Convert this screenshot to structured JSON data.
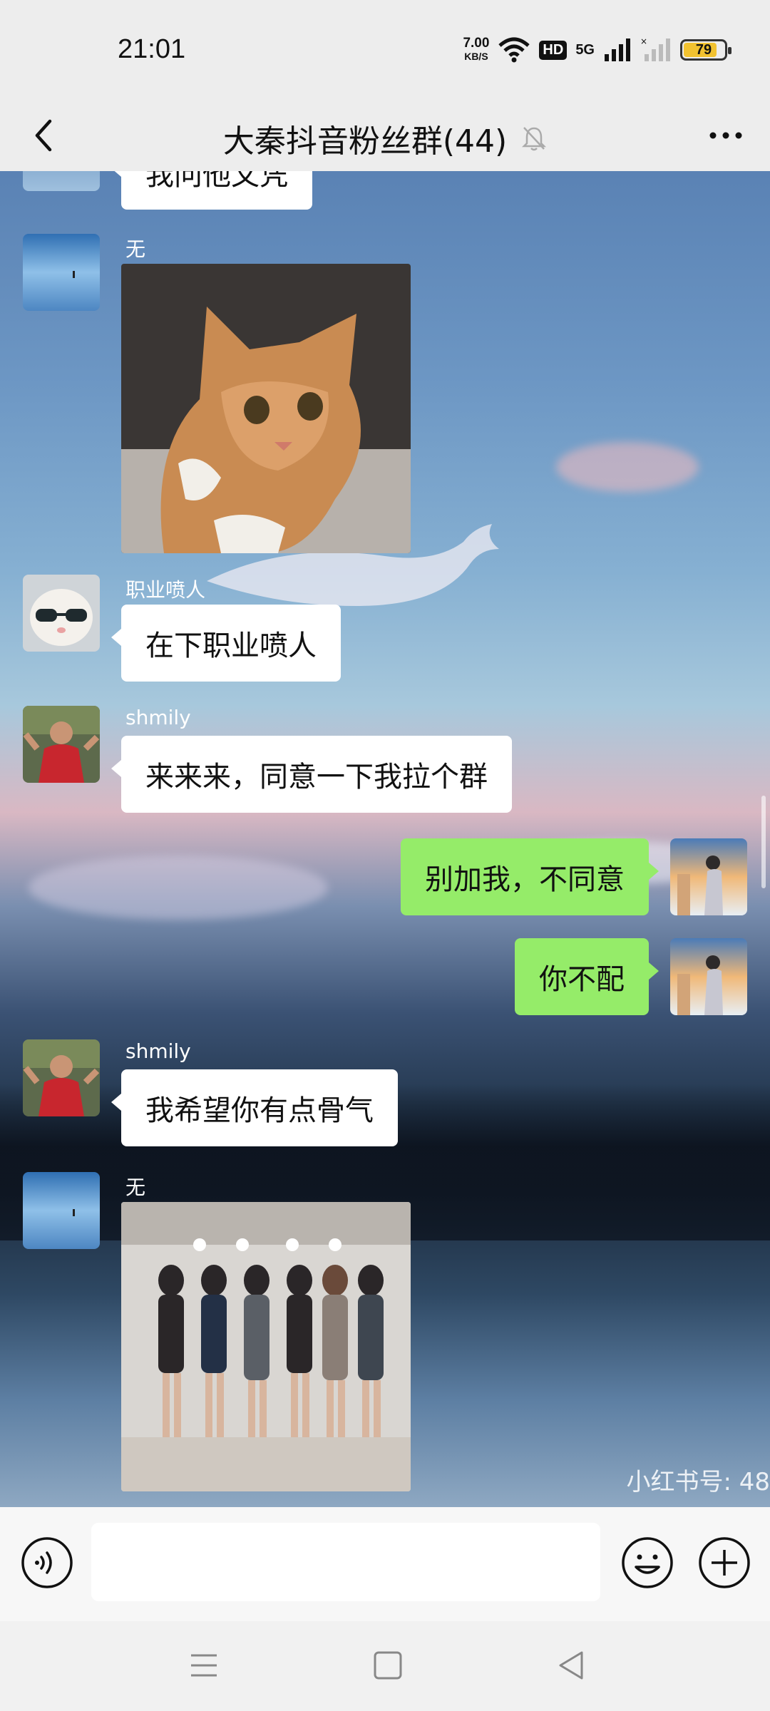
{
  "status_bar": {
    "time": "21:01",
    "net_speed": "7.00",
    "net_unit": "KB/S",
    "hd": "HD",
    "network": "5G",
    "battery": "79"
  },
  "header": {
    "title": "大秦抖音粉丝群(44)"
  },
  "messages": [
    {
      "text": "我问他文凭"
    },
    {
      "sender": "无"
    },
    {
      "sender": "职业喷人",
      "text": "在下职业喷人"
    },
    {
      "sender": "shmily",
      "text": "来来来，同意一下我拉个群"
    },
    {
      "text": "别加我，不同意"
    },
    {
      "text": "你不配"
    },
    {
      "sender": "shmily",
      "text": "我希望你有点骨气"
    },
    {
      "sender": "无"
    }
  ],
  "watermark": "小红书号: 48",
  "input": {
    "placeholder": ""
  },
  "colors": {
    "bubble_self": "#95ec69",
    "bubble_other": "#ffffff",
    "chrome": "#ededed"
  }
}
